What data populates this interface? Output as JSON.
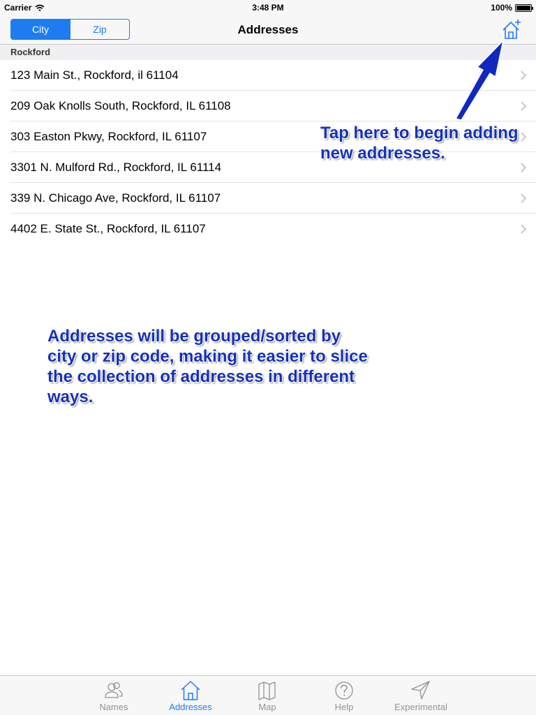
{
  "status_bar": {
    "carrier": "Carrier",
    "time": "3:48 PM",
    "battery": "100%"
  },
  "nav": {
    "title": "Addresses",
    "segments": [
      "City",
      "Zip"
    ],
    "selected_segment": "City",
    "add_icon": "home-plus-icon"
  },
  "section": {
    "header": "Rockford"
  },
  "addresses": [
    "123 Main St., Rockford, il 61104",
    "209 Oak Knolls South, Rockford, IL 61108",
    "303 Easton Pkwy, Rockford, IL 61107",
    "3301 N. Mulford Rd., Rockford, IL 61114",
    "339 N. Chicago Ave, Rockford, IL 61107",
    "4402 E. State St., Rockford, IL 61107"
  ],
  "annotations": {
    "add_tip_line1": "Tap here to begin adding",
    "add_tip_line2": "new addresses.",
    "group_tip_line1": "Addresses will be grouped/sorted by",
    "group_tip_line2": "city or zip code, making it easier to slice",
    "group_tip_line3": "the collection of addresses in different",
    "group_tip_line4": "ways."
  },
  "tabs": [
    {
      "label": "Names",
      "icon": "people-icon"
    },
    {
      "label": "Addresses",
      "icon": "house-icon"
    },
    {
      "label": "Map",
      "icon": "map-icon"
    },
    {
      "label": "Help",
      "icon": "question-icon"
    },
    {
      "label": "Experimental",
      "icon": "paper-plane-icon"
    }
  ],
  "selected_tab": "Addresses",
  "colors": {
    "accent": "#1d7cf2",
    "annotation": "#1531b8",
    "tab_inactive": "#929292"
  }
}
